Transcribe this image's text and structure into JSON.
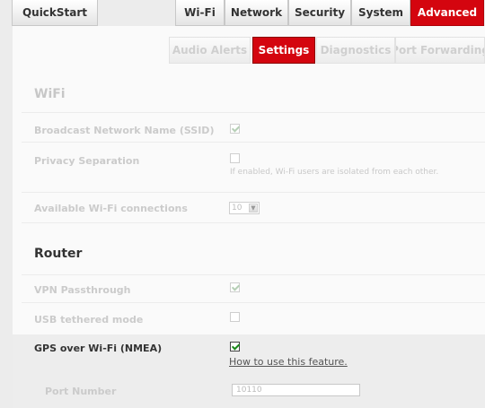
{
  "top_nav": {
    "quickstart": "QuickStart",
    "tabs": [
      "Wi-Fi",
      "Network",
      "Security",
      "System",
      "Advanced"
    ],
    "active": "Advanced"
  },
  "sub_nav": {
    "tabs": [
      "Audio Alerts",
      "Settings",
      "Diagnostics",
      "Port Forwarding"
    ],
    "active": "Settings"
  },
  "wifi": {
    "title": "WiFi",
    "broadcast_ssid": {
      "label": "Broadcast Network Name (SSID)",
      "checked": true
    },
    "privacy_separation": {
      "label": "Privacy Separation",
      "checked": false,
      "help": "If enabled, Wi-Fi users are isolated from each other."
    },
    "available_connections": {
      "label": "Available Wi-Fi connections",
      "value": "10"
    }
  },
  "router": {
    "title": "Router",
    "vpn_passthrough": {
      "label": "VPN Passthrough",
      "checked": true
    },
    "usb_tethered": {
      "label": "USB tethered mode",
      "checked": false
    },
    "gps_nmea": {
      "label": "GPS over Wi-Fi (NMEA)",
      "checked": true,
      "link": "How to use this feature."
    },
    "port_number": {
      "label": "Port Number",
      "value": "10110"
    }
  },
  "colors": {
    "accent": "#d4050f",
    "panel": "#fafafa",
    "background": "#ececec"
  }
}
